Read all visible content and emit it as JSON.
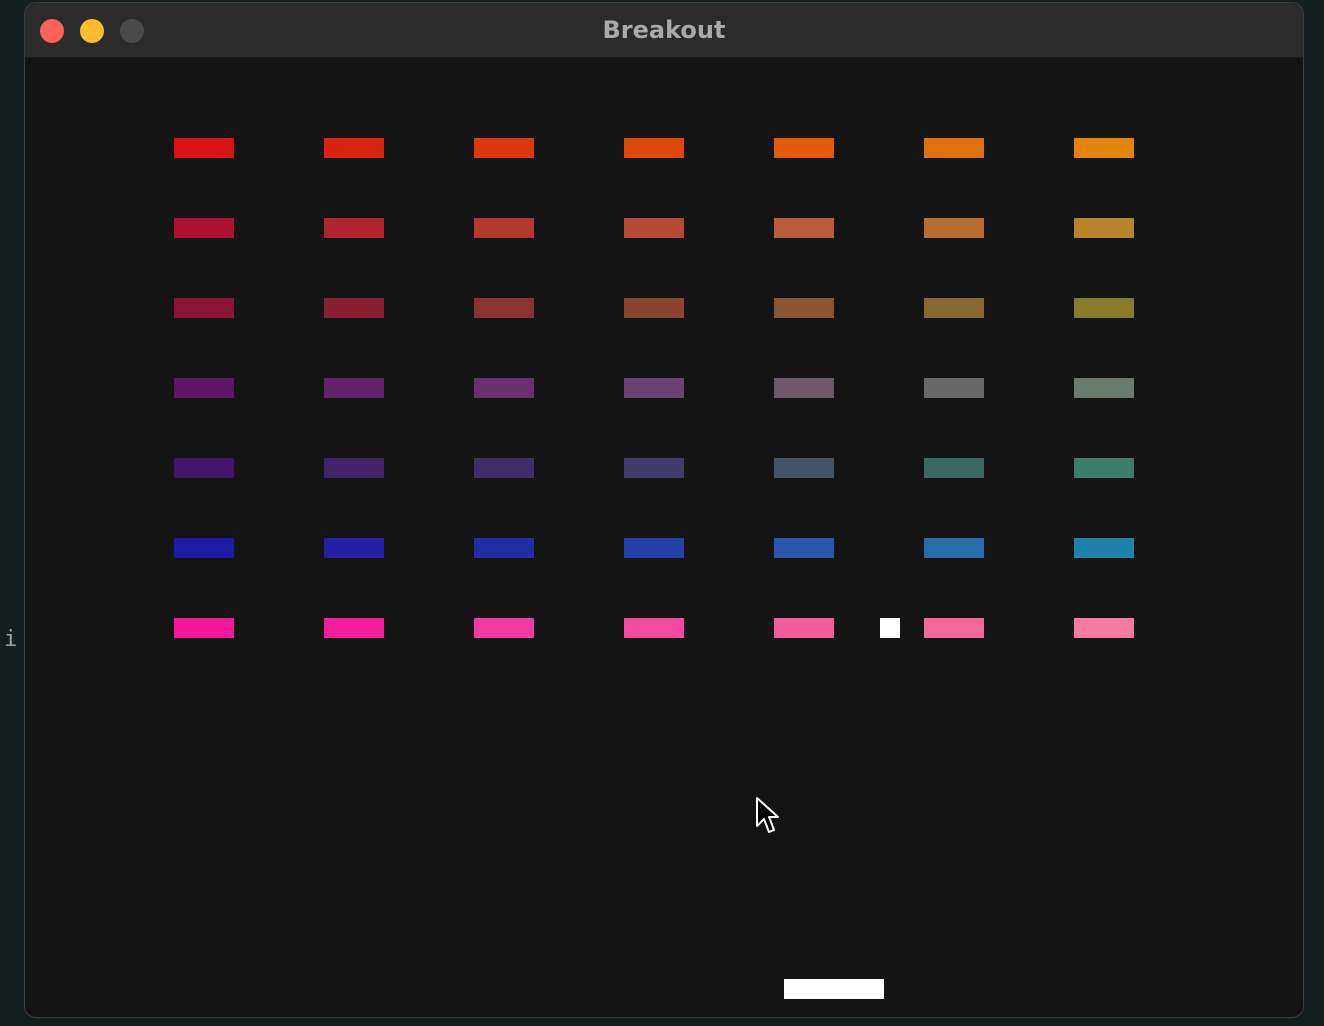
{
  "backdrop": {
    "text": "i"
  },
  "window": {
    "title": "Breakout",
    "controls": {
      "close_color": "#fe5f57",
      "minimize_color": "#febc2e",
      "maximize_color": "#4a4a4a"
    }
  },
  "game": {
    "background_color": "#141414",
    "brick_columns": 7,
    "brick_rows": 7,
    "bricks": [
      [
        "#d71414",
        "#d9240f",
        "#da350d",
        "#dd480b",
        "#e05c0a",
        "#e07009",
        "#e0850a"
      ],
      [
        "#ab1234",
        "#b1232f",
        "#b3382f",
        "#b54a37",
        "#b85c3a",
        "#b86e33",
        "#b8842e"
      ],
      [
        "#891436",
        "#891f30",
        "#8a3331",
        "#8a4432",
        "#8a5533",
        "#876a31",
        "#877c2c"
      ],
      [
        "#5e1766",
        "#63236a",
        "#67326d",
        "#6a4272",
        "#6b586b",
        "#696969",
        "#6a7c6c"
      ],
      [
        "#41156b",
        "#412368",
        "#3f2f67",
        "#3f3c6a",
        "#435469",
        "#3d6864",
        "#3c7c6b"
      ],
      [
        "#1e1aa4",
        "#2520a6",
        "#222fa4",
        "#2540a9",
        "#2857ac",
        "#286ca9",
        "#2081ac"
      ],
      [
        "#f3179c",
        "#f21e9b",
        "#f23c9f",
        "#f34b9f",
        "#f25c9b",
        "#f4699c",
        "#f57a9f"
      ]
    ],
    "ball": {
      "color": "#ffffff"
    },
    "paddle": {
      "color": "#ffffff"
    }
  }
}
